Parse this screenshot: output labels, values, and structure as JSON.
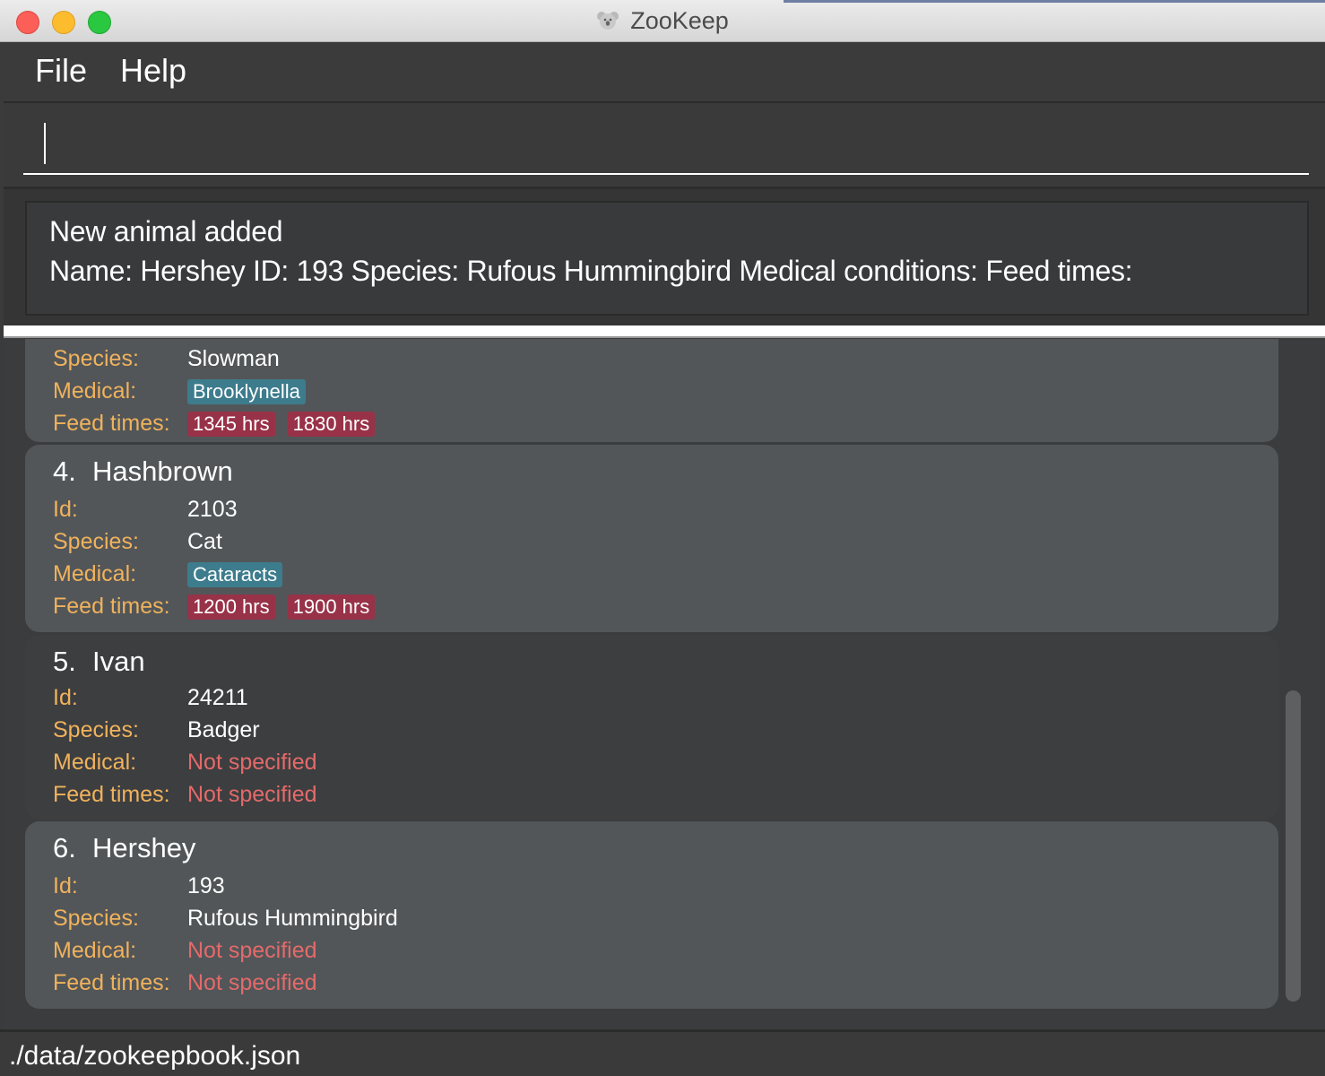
{
  "window": {
    "title": "ZooKeep",
    "app_icon": "koala-icon"
  },
  "menu": {
    "file": "File",
    "help": "Help"
  },
  "command": {
    "value": ""
  },
  "result": {
    "line1": "New animal added",
    "line2": "Name: Hershey ID: 193 Species: Rufous Hummingbird Medical conditions:  Feed times:"
  },
  "labels": {
    "id": "Id:",
    "species": "Species:",
    "medical": "Medical:",
    "feed": "Feed times:"
  },
  "animals": [
    {
      "index": "",
      "name": "",
      "id": "",
      "species": "Slowman",
      "medical": [
        "Brooklynella"
      ],
      "feed": [
        "1345 hrs",
        "1830 hrs"
      ]
    },
    {
      "index": "4.",
      "name": "Hashbrown",
      "id": "2103",
      "species": "Cat",
      "medical": [
        "Cataracts"
      ],
      "feed": [
        "1200 hrs",
        "1900 hrs"
      ]
    },
    {
      "index": "5.",
      "name": "Ivan",
      "id": "24211",
      "species": "Badger",
      "medical_text": "Not specified",
      "feed_text": "Not specified"
    },
    {
      "index": "6.",
      "name": "Hershey",
      "id": "193",
      "species": "Rufous Hummingbird",
      "medical_text": "Not specified",
      "feed_text": "Not specified"
    }
  ],
  "status": {
    "path": "./data/zookeepbook.json"
  },
  "colors": {
    "label": "#f0b25c",
    "medical_tag": "#3d7c8d",
    "feed_tag": "#983248",
    "not_specified": "#e46a6a"
  }
}
